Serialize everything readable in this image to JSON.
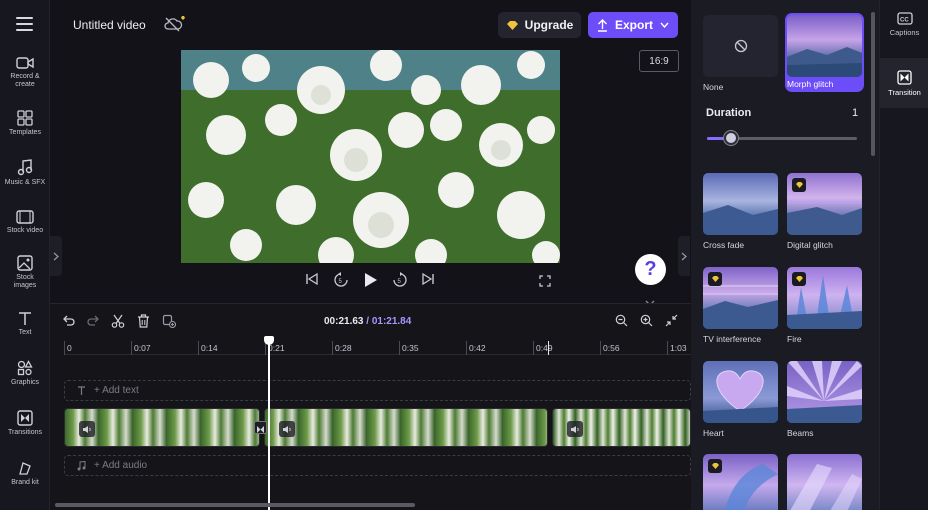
{
  "header": {
    "title": "Untitled video",
    "upgrade_label": "Upgrade",
    "export_label": "Export"
  },
  "left_rail": {
    "items": [
      {
        "label": "Record & create",
        "icon": "video-camera-icon"
      },
      {
        "label": "Templates",
        "icon": "templates-icon"
      },
      {
        "label": "Music & SFX",
        "icon": "music-note-icon"
      },
      {
        "label": "Stock video",
        "icon": "film-icon"
      },
      {
        "label": "Stock images",
        "icon": "image-icon"
      },
      {
        "label": "Text",
        "icon": "text-icon"
      },
      {
        "label": "Graphics",
        "icon": "shapes-icon"
      },
      {
        "label": "Transitions",
        "icon": "transitions-icon"
      },
      {
        "label": "Brand kit",
        "icon": "brand-kit-icon"
      }
    ]
  },
  "preview": {
    "aspect_ratio": "16:9"
  },
  "timeline": {
    "current_time": "00:21.63",
    "separator": "/",
    "total_time": "01:21.84",
    "ruler_labels": [
      "0",
      "0:07",
      "0:14",
      "0:21",
      "0:28",
      "0:35",
      "0:42",
      "0:49",
      "0:56",
      "1:03"
    ],
    "add_text": "+ Add text",
    "add_audio": "+ Add audio"
  },
  "transition_panel": {
    "duration_label": "Duration",
    "duration_value": "1",
    "duration_fraction": 0.1,
    "cards": [
      {
        "name": "None",
        "premium": false
      },
      {
        "name": "Morph glitch",
        "premium": false,
        "selected": true
      },
      {
        "name": "Cross fade",
        "premium": false
      },
      {
        "name": "Digital glitch",
        "premium": true
      },
      {
        "name": "TV interference",
        "premium": true
      },
      {
        "name": "Fire",
        "premium": true
      },
      {
        "name": "Heart",
        "premium": false
      },
      {
        "name": "Beams",
        "premium": false
      },
      {
        "name": "",
        "premium": true
      },
      {
        "name": "",
        "premium": false
      }
    ]
  },
  "right_rail": {
    "items": [
      {
        "label": "Captions",
        "icon": "captions-icon"
      },
      {
        "label": "Transition",
        "icon": "transition-icon"
      }
    ]
  },
  "colors": {
    "accent": "#6c4df7",
    "selected_border": "#7b5cff",
    "time_total": "#a996ff"
  }
}
